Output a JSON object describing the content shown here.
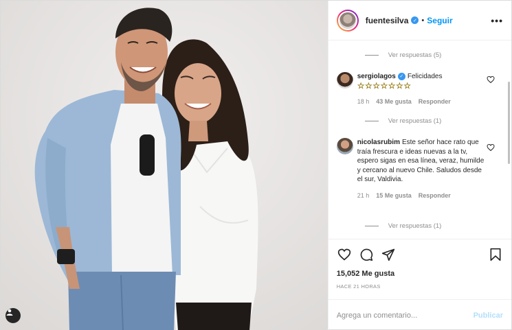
{
  "post": {
    "author": {
      "username": "fuentesilva",
      "verified": true,
      "follow_label": "Seguir"
    },
    "more_icon": "more-horizontal-icon",
    "comments": [
      {
        "type": "replies",
        "label": "Ver respuestas (5)"
      },
      {
        "username": "sergiolagos",
        "verified": true,
        "text": "Felicidades",
        "stars": "☆☆☆☆☆☆☆",
        "age": "18 h",
        "likes": "43 Me gusta",
        "reply_label": "Responder",
        "replies_label": "Ver respuestas (1)"
      },
      {
        "username": "nicolasrubim",
        "verified": false,
        "text": "Este señor hace rato que traía frescura e ideas nuevas a la tv, espero sigas en esa línea, veraz, humilde y cercano al nuevo Chile. Saludos desde el sur, Valdivia.",
        "age": "21 h",
        "likes": "15 Me gusta",
        "reply_label": "Responder",
        "replies_label": "Ver respuestas (1)"
      }
    ],
    "actions": {
      "like_icon": "heart-icon",
      "comment_icon": "comment-icon",
      "share_icon": "share-icon",
      "save_icon": "bookmark-icon"
    },
    "likes": "15,052 Me gusta",
    "timestamp": "HACE 21 HORAS",
    "add_comment": {
      "placeholder": "Agrega un comentario...",
      "publish_label": "Publicar"
    },
    "colors": {
      "accent": "#0095f6",
      "verified": "#3897f0",
      "muted": "#8e8e8e",
      "publish_disabled": "#b2dffc"
    }
  }
}
